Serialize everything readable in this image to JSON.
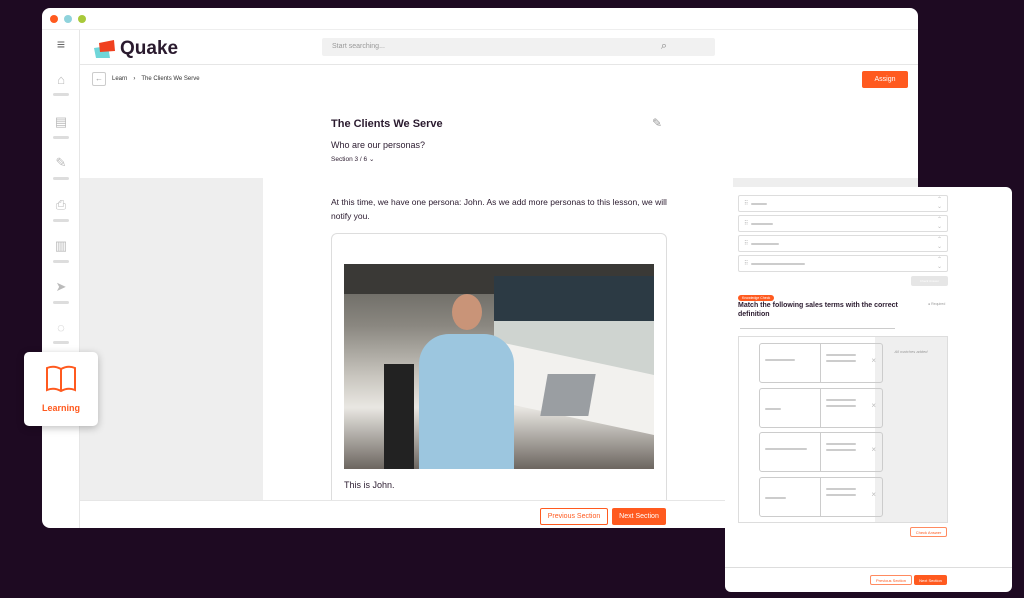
{
  "window": {
    "dots": [
      "#ff5a1f",
      "#8fd3dc",
      "#a8c93a"
    ]
  },
  "header": {
    "logo": "Quake",
    "search_placeholder": "Start searching..."
  },
  "sidebar": {
    "items": [
      "home-icon",
      "notes-icon",
      "tools-icon",
      "inbox-icon",
      "chart-icon",
      "send-icon",
      "chat-icon"
    ],
    "active_label": "Learning"
  },
  "breadcrumb": {
    "parent": "Learn",
    "current": "The Clients We Serve"
  },
  "assign_label": "Assign",
  "lesson": {
    "title": "The Clients We Serve",
    "subtitle": "Who are our personas?",
    "section": "Section 3 / 6",
    "body": "At this time, we have one persona: John. As we add more personas to this lesson, we will notify you.",
    "caption": "This is John."
  },
  "footer": {
    "previous": "Previous Section",
    "next": "Next Section"
  },
  "panel": {
    "check_answer_top": "Check Answer",
    "badge": "Knowledge Check",
    "question": "Match the following sales terms with the correct definition",
    "required": "Required",
    "all_matches": "All matches added",
    "check_answer": "Check Answer",
    "previous": "Previous Section",
    "next": "Next Section"
  },
  "colors": {
    "accent": "#ff5a1f",
    "background": "#1e0a22"
  }
}
